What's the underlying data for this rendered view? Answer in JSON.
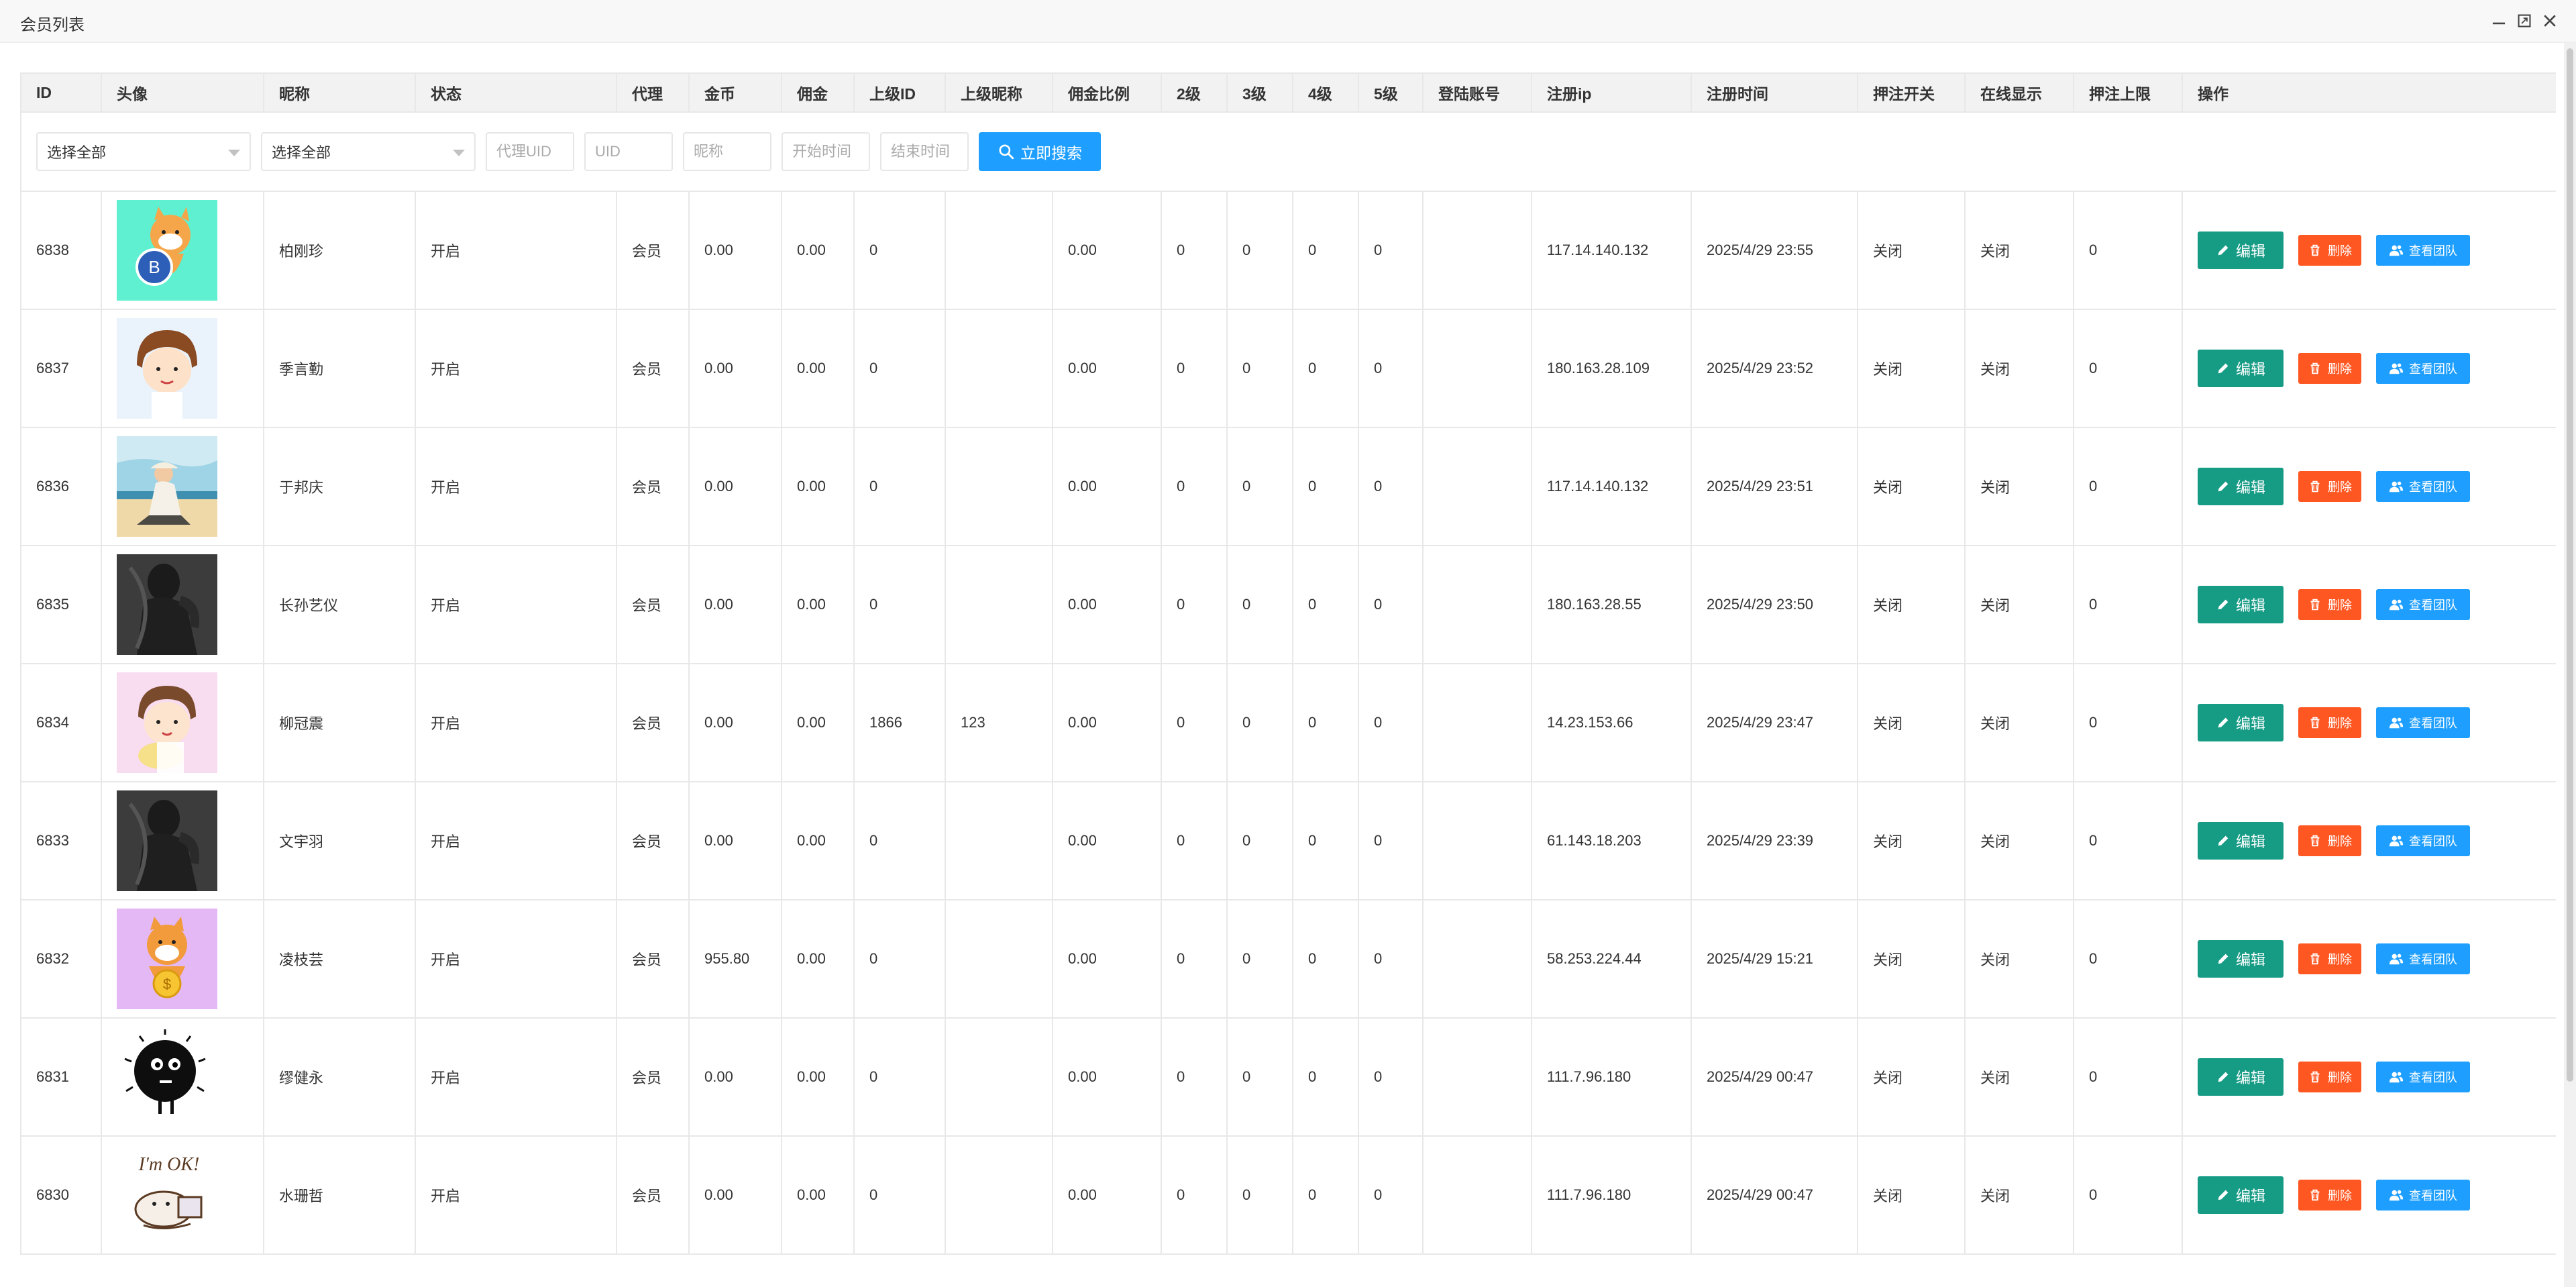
{
  "window": {
    "title": "会员列表"
  },
  "columns": [
    "ID",
    "头像",
    "昵称",
    "状态",
    "代理",
    "金币",
    "佣金",
    "上级ID",
    "上级昵称",
    "佣金比例",
    "2级",
    "3级",
    "4级",
    "5级",
    "登陆账号",
    "注册ip",
    "注册时间",
    "押注开关",
    "在线显示",
    "押注上限",
    "操作"
  ],
  "search": {
    "select1": "选择全部",
    "select2": "选择全部",
    "agent_uid_placeholder": "代理UID",
    "uid_placeholder": "UID",
    "nickname_placeholder": "昵称",
    "start_time_placeholder": "开始时间",
    "end_time_placeholder": "结束时间",
    "search_button": "立即搜索"
  },
  "actions": {
    "edit": "编辑",
    "delete": "删除",
    "team": "查看团队"
  },
  "colors": {
    "edit": "#169b85",
    "delete": "#ff5722",
    "team": "#1e9fff",
    "on": "#2e9a0b",
    "off": "#ff1a1a"
  },
  "rows": [
    {
      "id": "6838",
      "avatar": "shiba-coin-teal",
      "nickname": "柏刚珍",
      "status": "开启",
      "agent": "会员",
      "coins": "0.00",
      "commission": "0.00",
      "parent_id": "0",
      "parent_name": "",
      "ratio": "0.00",
      "l2": "0",
      "l3": "0",
      "l4": "0",
      "l5": "0",
      "login": "",
      "ip": "117.14.140.132",
      "reg_time": "2025/4/29 23:55",
      "bet_switch": "关闭",
      "online": "关闭",
      "bet_limit": "0"
    },
    {
      "id": "6837",
      "avatar": "cartoon-girl",
      "nickname": "季言勤",
      "status": "开启",
      "agent": "会员",
      "coins": "0.00",
      "commission": "0.00",
      "parent_id": "0",
      "parent_name": "",
      "ratio": "0.00",
      "l2": "0",
      "l3": "0",
      "l4": "0",
      "l5": "0",
      "login": "",
      "ip": "180.163.28.109",
      "reg_time": "2025/4/29 23:52",
      "bet_switch": "关闭",
      "online": "关闭",
      "bet_limit": "0"
    },
    {
      "id": "6836",
      "avatar": "beach-person",
      "nickname": "于邦庆",
      "status": "开启",
      "agent": "会员",
      "coins": "0.00",
      "commission": "0.00",
      "parent_id": "0",
      "parent_name": "",
      "ratio": "0.00",
      "l2": "0",
      "l3": "0",
      "l4": "0",
      "l5": "0",
      "login": "",
      "ip": "117.14.140.132",
      "reg_time": "2025/4/29 23:51",
      "bet_switch": "关闭",
      "online": "关闭",
      "bet_limit": "0"
    },
    {
      "id": "6835",
      "avatar": "dark-figure",
      "nickname": "长孙艺仪",
      "status": "开启",
      "agent": "会员",
      "coins": "0.00",
      "commission": "0.00",
      "parent_id": "0",
      "parent_name": "",
      "ratio": "0.00",
      "l2": "0",
      "l3": "0",
      "l4": "0",
      "l5": "0",
      "login": "",
      "ip": "180.163.28.55",
      "reg_time": "2025/4/29 23:50",
      "bet_switch": "关闭",
      "online": "关闭",
      "bet_limit": "0"
    },
    {
      "id": "6834",
      "avatar": "cartoon-girl-pink",
      "nickname": "柳冠震",
      "status": "开启",
      "agent": "会员",
      "coins": "0.00",
      "commission": "0.00",
      "parent_id": "1866",
      "parent_name": "123",
      "ratio": "0.00",
      "l2": "0",
      "l3": "0",
      "l4": "0",
      "l5": "0",
      "login": "",
      "ip": "14.23.153.66",
      "reg_time": "2025/4/29 23:47",
      "bet_switch": "关闭",
      "online": "关闭",
      "bet_limit": "0"
    },
    {
      "id": "6833",
      "avatar": "dark-figure",
      "nickname": "文宇羽",
      "status": "开启",
      "agent": "会员",
      "coins": "0.00",
      "commission": "0.00",
      "parent_id": "0",
      "parent_name": "",
      "ratio": "0.00",
      "l2": "0",
      "l3": "0",
      "l4": "0",
      "l5": "0",
      "login": "",
      "ip": "61.143.18.203",
      "reg_time": "2025/4/29 23:39",
      "bet_switch": "关闭",
      "online": "关闭",
      "bet_limit": "0"
    },
    {
      "id": "6832",
      "avatar": "shiba-coin-purple",
      "nickname": "凌枝芸",
      "status": "开启",
      "agent": "会员",
      "coins": "955.80",
      "commission": "0.00",
      "parent_id": "0",
      "parent_name": "",
      "ratio": "0.00",
      "l2": "0",
      "l3": "0",
      "l4": "0",
      "l5": "0",
      "login": "",
      "ip": "58.253.224.44",
      "reg_time": "2025/4/29 15:21",
      "bet_switch": "关闭",
      "online": "关闭",
      "bet_limit": "0"
    },
    {
      "id": "6831",
      "avatar": "black-fuzzball",
      "nickname": "缪健永",
      "status": "开启",
      "agent": "会员",
      "coins": "0.00",
      "commission": "0.00",
      "parent_id": "0",
      "parent_name": "",
      "ratio": "0.00",
      "l2": "0",
      "l3": "0",
      "l4": "0",
      "l5": "0",
      "login": "",
      "ip": "111.7.96.180",
      "reg_time": "2025/4/29 00:47",
      "bet_switch": "关闭",
      "online": "关闭",
      "bet_limit": "0"
    },
    {
      "id": "6830",
      "avatar": "im-ok-sticker",
      "nickname": "水珊哲",
      "status": "开启",
      "agent": "会员",
      "coins": "0.00",
      "commission": "0.00",
      "parent_id": "0",
      "parent_name": "",
      "ratio": "0.00",
      "l2": "0",
      "l3": "0",
      "l4": "0",
      "l5": "0",
      "login": "",
      "ip": "111.7.96.180",
      "reg_time": "2025/4/29 00:47",
      "bet_switch": "关闭",
      "online": "关闭",
      "bet_limit": "0"
    }
  ]
}
